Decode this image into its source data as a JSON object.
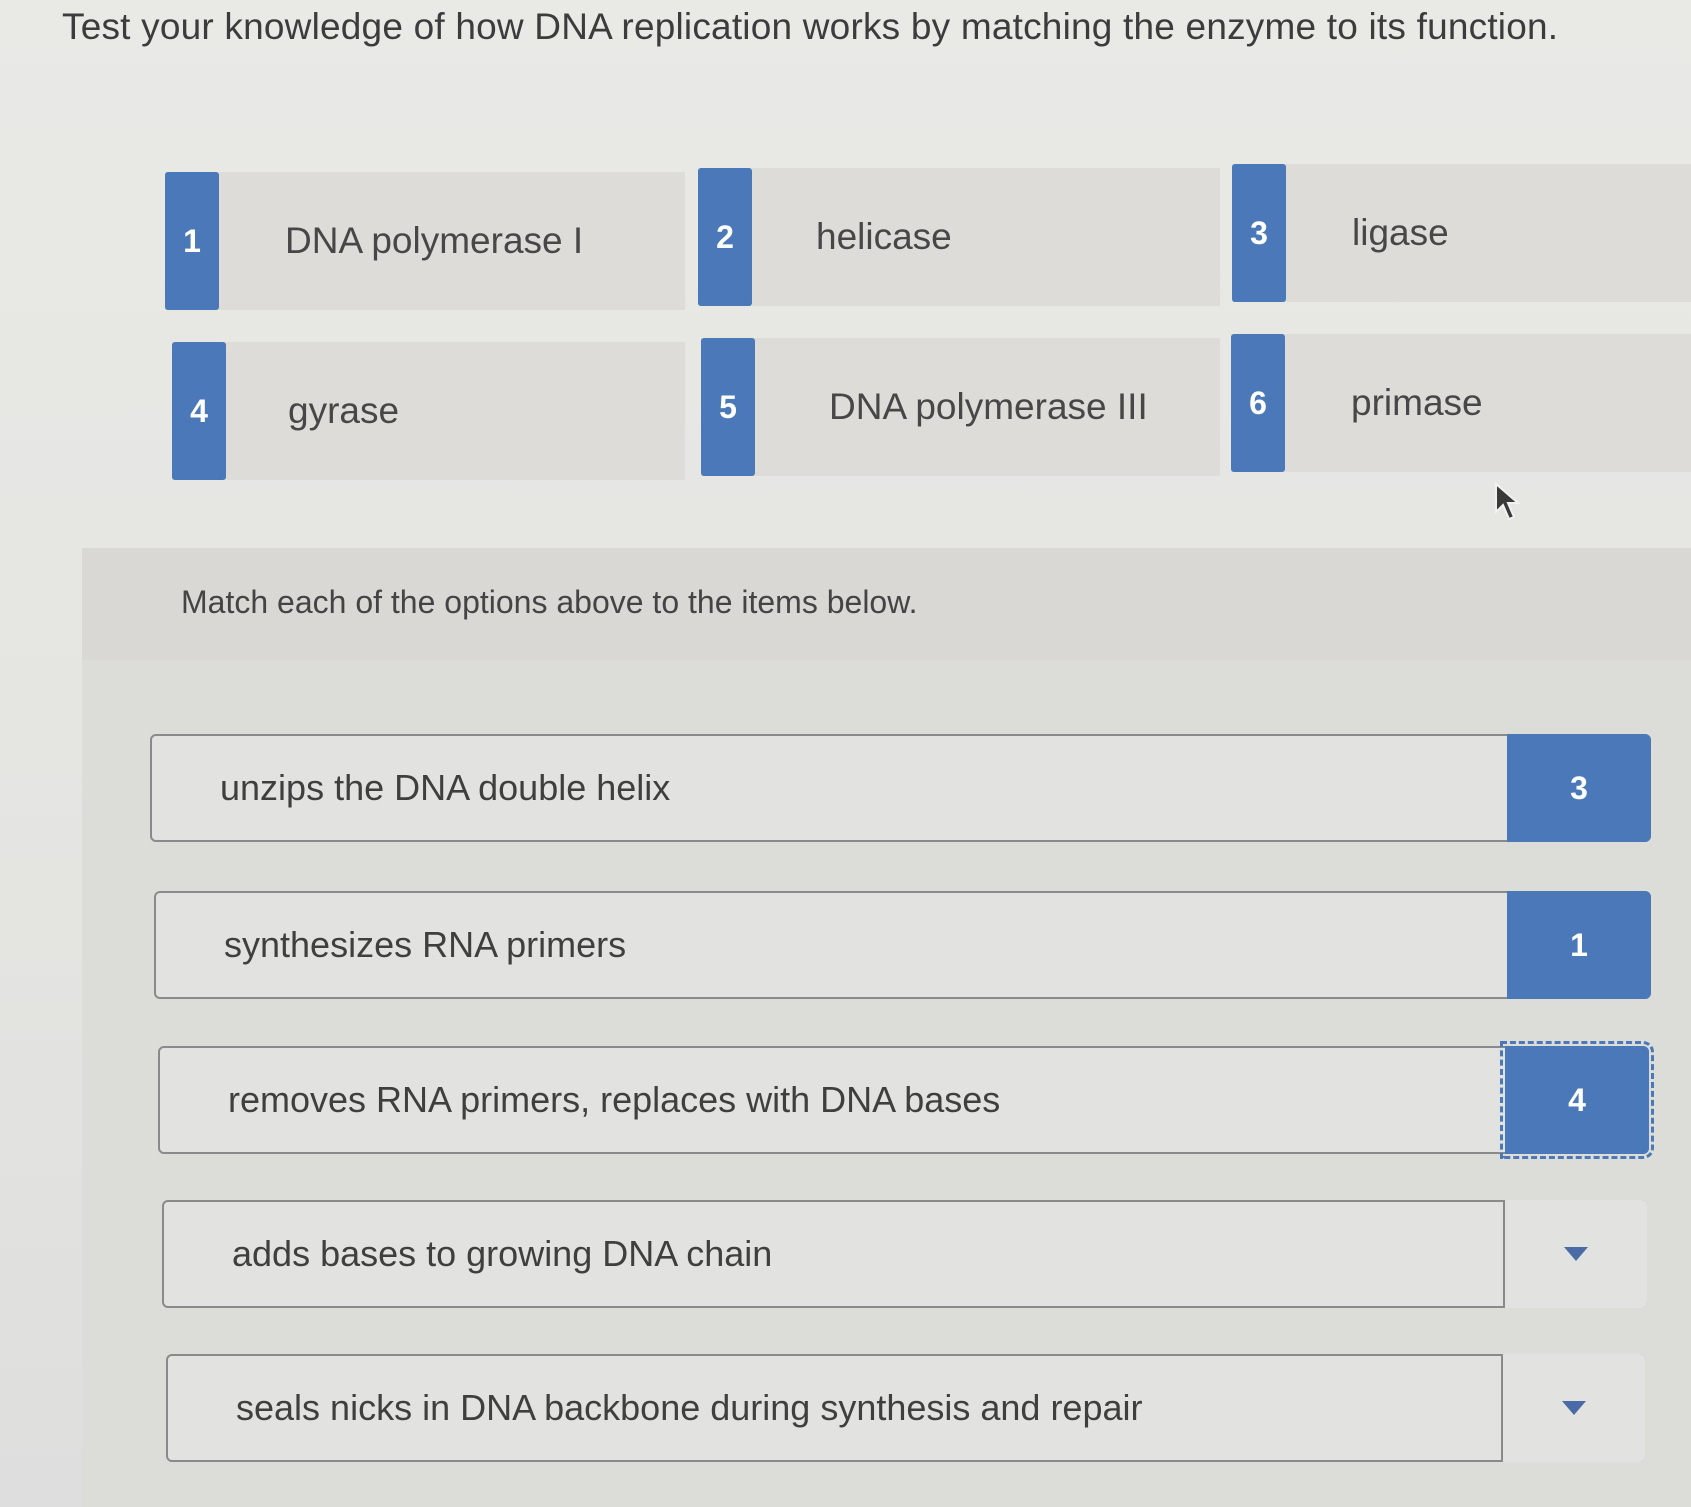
{
  "instructions": "Test your knowledge of how DNA replication works by matching the enzyme to its function.",
  "options": [
    {
      "number": "1",
      "label": "DNA polymerase I"
    },
    {
      "number": "2",
      "label": "helicase"
    },
    {
      "number": "3",
      "label": "ligase"
    },
    {
      "number": "4",
      "label": "gyrase"
    },
    {
      "number": "5",
      "label": "DNA polymerase III"
    },
    {
      "number": "6",
      "label": "primase"
    }
  ],
  "match": {
    "prompt": "Match each of the options above to the items below.",
    "items": [
      {
        "text": "unzips the DNA double helix",
        "answer": "3"
      },
      {
        "text": "synthesizes RNA primers",
        "answer": "1"
      },
      {
        "text": "removes RNA primers, replaces with DNA bases",
        "answer": "4"
      },
      {
        "text": "adds bases to growing DNA chain",
        "answer": ""
      },
      {
        "text": "seals nicks in DNA backbone during synthesis and repair",
        "answer": ""
      }
    ]
  },
  "colors": {
    "accent": "#4a78b8",
    "tile": "#dedcd9",
    "background": "#e6e6e3"
  }
}
